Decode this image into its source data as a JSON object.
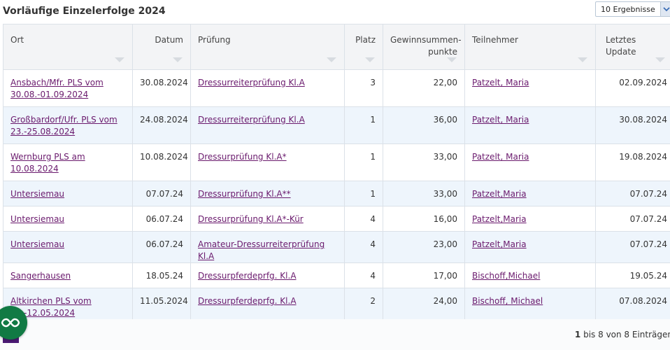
{
  "title": "Vorläufige Einzelerfolge 2024",
  "page_length_select": {
    "value": "10 Ergebnisse"
  },
  "columns": {
    "ort": "Ort",
    "datum": "Datum",
    "pruefung": "Prüfung",
    "platz": "Platz",
    "gewinnsumme_1": "Gewinnsummen-",
    "gewinnsumme_2": "punkte",
    "teilnehmer": "Teilnehmer",
    "update": "Letztes Update"
  },
  "rows": [
    {
      "ort": "Ansbach/Mfr. PLS vom 30.08.-01.09.2024",
      "datum": "30.08.2024",
      "pruefung": "Dressurreiterprüfung Kl.A",
      "platz": "3",
      "punkte": "22,00",
      "teilnehmer": "Patzelt, Maria",
      "update": "02.09.2024"
    },
    {
      "ort": "Großbardorf/Ufr. PLS vom 23.-25.08.2024",
      "datum": "24.08.2024",
      "pruefung": "Dressurreiterprüfung Kl.A",
      "platz": "1",
      "punkte": "36,00",
      "teilnehmer": "Patzelt, Maria",
      "update": "30.08.2024"
    },
    {
      "ort": "Wernburg PLS am 10.08.2024",
      "datum": "10.08.2024",
      "pruefung": "Dressurprüfung Kl.A*",
      "platz": "1",
      "punkte": "33,00",
      "teilnehmer": "Patzelt, Maria",
      "update": "19.08.2024"
    },
    {
      "ort": "Untersiemau",
      "datum": "07.07.24",
      "pruefung": "Dressurprüfung Kl.A**",
      "platz": "1",
      "punkte": "33,00",
      "teilnehmer": "Patzelt,Maria",
      "update": "07.07.24"
    },
    {
      "ort": "Untersiemau",
      "datum": "06.07.24",
      "pruefung": "Dressurprüfung Kl.A*-Kür",
      "platz": "4",
      "punkte": "16,00",
      "teilnehmer": "Patzelt,Maria",
      "update": "07.07.24"
    },
    {
      "ort": "Untersiemau",
      "datum": "06.07.24",
      "pruefung": "Amateur-Dressurreiterprüfung Kl.A",
      "platz": "4",
      "punkte": "23,00",
      "teilnehmer": "Patzelt,Maria",
      "update": "07.07.24"
    },
    {
      "ort": "Sangerhausen",
      "datum": "18.05.24",
      "pruefung": "Dressurpferdeprfg. Kl.A",
      "platz": "4",
      "punkte": "17,00",
      "teilnehmer": "Bischoff,Michael",
      "update": "19.05.24"
    },
    {
      "ort": "Altkirchen PLS vom 11.-12.05.2024",
      "datum": "11.05.2024",
      "pruefung": "Dressurpferdeprfg. Kl.A",
      "platz": "2",
      "punkte": "24,00",
      "teilnehmer": "Bischoff, Michael",
      "update": "07.08.2024"
    }
  ],
  "footer": {
    "info_bold": "1",
    "info_rest": " bis 8 von 8 Einträgen"
  },
  "icons": {
    "fab": "infinity-icon",
    "select_arrow": "chevron-down-icon",
    "sort": "sort-arrow-icon"
  },
  "colors": {
    "link": "#6a1a6d",
    "row_alt": "#eef5fc",
    "fab": "#117a44",
    "accent": "#4b1a74"
  }
}
